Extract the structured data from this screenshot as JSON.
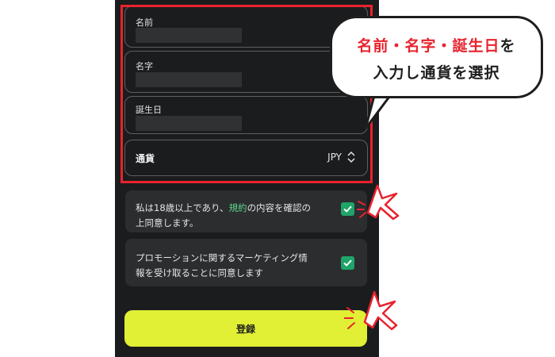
{
  "form": {
    "first_name_label": "名前",
    "last_name_label": "名字",
    "birthday_label": "誕生日",
    "currency_label": "通貨",
    "currency_value": "JPY"
  },
  "consents": [
    {
      "line1_before": "私は18歳以上であり、",
      "link": "規約",
      "line1_after": "の内容を確認の",
      "line2": "上同意します。",
      "checked": true
    },
    {
      "line1": "プロモーションに関するマーケティング情",
      "line2": "報を受け取ることに同意します",
      "checked": true
    }
  ],
  "register_label": "登録",
  "callout": {
    "line1_red": "名前・名字・誕生日",
    "line1_black": "を",
    "line2": "入力し通貨を選択"
  },
  "colors": {
    "accent_button": "#e1ef35",
    "checkbox": "#1fa46a",
    "highlight": "#e8232e",
    "link": "#5cd68f"
  }
}
